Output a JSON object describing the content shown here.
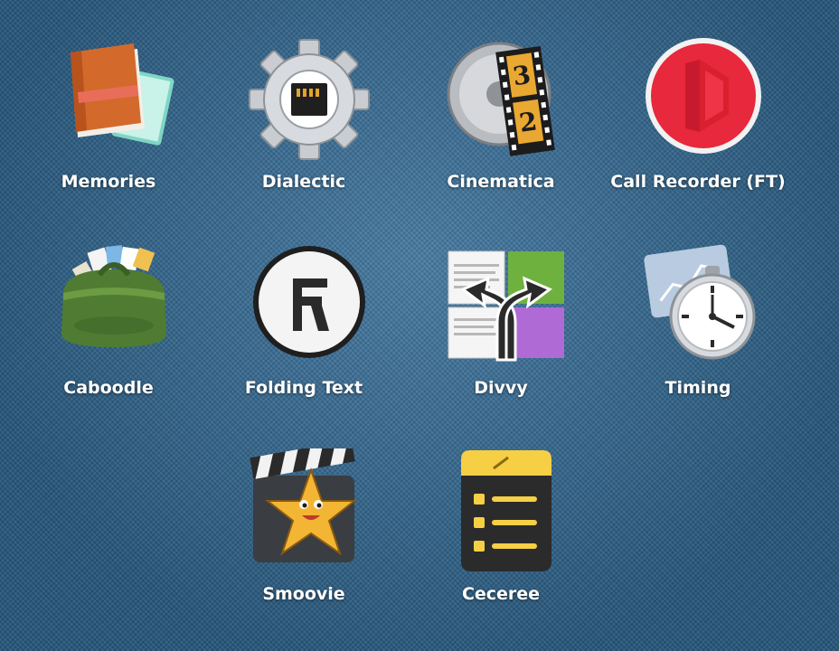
{
  "apps": [
    {
      "label": "Memories",
      "icon": "memories-book-icon"
    },
    {
      "label": "Dialectic",
      "icon": "dialectic-gear-icon"
    },
    {
      "label": "Cinematica",
      "icon": "cinematica-film-reel-icon"
    },
    {
      "label": "Call Recorder (FT)",
      "icon": "call-recorder-icon"
    },
    {
      "label": "Caboodle",
      "icon": "caboodle-bag-icon"
    },
    {
      "label": "Folding Text",
      "icon": "folding-text-icon"
    },
    {
      "label": "Divvy",
      "icon": "divvy-arrows-icon"
    },
    {
      "label": "Timing",
      "icon": "timing-stopwatch-icon"
    },
    {
      "label": "Smoovie",
      "icon": "smoovie-clapper-star-icon"
    },
    {
      "label": "Ceceree",
      "icon": "ceceree-list-icon"
    }
  ],
  "film_countdown": [
    "3",
    "2"
  ],
  "colors": {
    "background": "#2f6a97",
    "label_text": "#ffffff",
    "call_recorder_red": "#e8283c",
    "ceceree_yellow": "#f6cf45"
  }
}
